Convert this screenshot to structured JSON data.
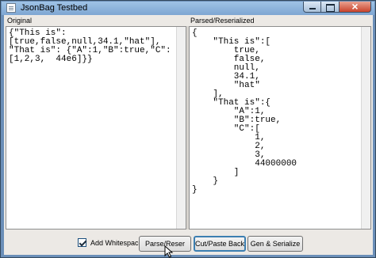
{
  "window": {
    "title": "JsonBag Testbed"
  },
  "left_pane": {
    "label": "Original",
    "content": "{\"This is\":\n[true,false,null,34.1,\"hat\"],\n\"That is\": {\"A\":1,\"B\":true,\"C\":\n[1,2,3,  44e6]}}"
  },
  "right_pane": {
    "label": "Parsed/Reserialized",
    "content": "{\n    \"This is\":[\n        true,\n        false,\n        null,\n        34.1,\n        \"hat\"\n    ],\n    \"That is\":{\n        \"A\":1,\n        \"B\":true,\n        \"C\":[\n            1,\n            2,\n            3,\n            44000000\n        ]\n    }\n}"
  },
  "controls": {
    "add_whitespace_label": "Add Whitespace",
    "add_whitespace_checked": true,
    "parse_button": "Parse/Reser",
    "cut_paste_button": "Cut/Paste Back",
    "gen_button": "Gen & Serialize"
  }
}
